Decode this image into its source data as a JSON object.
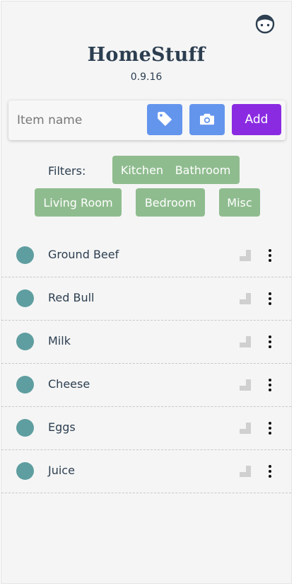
{
  "header": {
    "title": "HomeStuff",
    "version": "0.9.16",
    "avatar_icon": "face-icon"
  },
  "add_bar": {
    "placeholder": "Item name",
    "value": "",
    "tag_icon": "tag-icon",
    "camera_icon": "camera-icon",
    "add_label": "Add"
  },
  "filters": {
    "label": "Filters:",
    "chips": [
      "Kitchen",
      "Bathroom",
      "Living Room",
      "Bedroom",
      "Misc"
    ]
  },
  "items": [
    {
      "name": "Ground Beef"
    },
    {
      "name": "Red Bull"
    },
    {
      "name": "Milk"
    },
    {
      "name": "Cheese"
    },
    {
      "name": "Eggs"
    },
    {
      "name": "Juice"
    }
  ],
  "colors": {
    "primary_blue": "#6495ed",
    "add_purple": "#8a2be2",
    "chip_green": "#8fbc8f",
    "status_dot": "#5f9ea0",
    "text": "#2c3e50"
  }
}
